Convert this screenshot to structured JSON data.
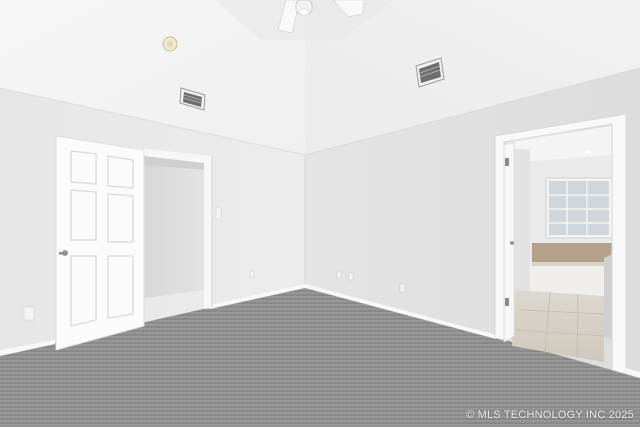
{
  "photo": {
    "subject": "empty bedroom with vaulted ceiling, open closet door and en-suite bathroom",
    "watermark": "© MLS TECHNOLOGY INC 2025"
  },
  "colors": {
    "ceiling": "#f4f4f4",
    "wall_left": "#e9e9e9",
    "wall_right": "#e2e2e2",
    "carpet": "#8f8f8f",
    "door": "#fbfbfb",
    "trim": "#f7f7f7",
    "bath_floor": "#d8d2c8",
    "window_glass": "#cfd6dc"
  }
}
